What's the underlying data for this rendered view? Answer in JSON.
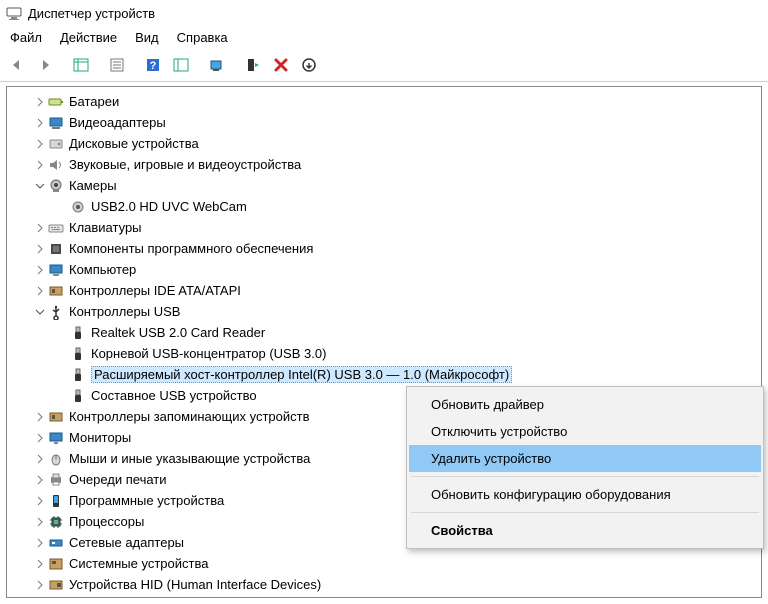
{
  "window": {
    "title": "Диспетчер устройств"
  },
  "menu": {
    "file": "Файл",
    "action": "Действие",
    "view": "Вид",
    "help": "Справка"
  },
  "tree": {
    "batteries": "Батареи",
    "video": "Видеоадаптеры",
    "disk": "Дисковые устройства",
    "sound": "Звуковые, игровые и видеоустройства",
    "cameras": "Камеры",
    "cam0": "USB2.0 HD UVC WebCam",
    "keyboards": "Клавиатуры",
    "software": "Компоненты программного обеспечения",
    "computer": "Компьютер",
    "ide": "Контроллеры IDE ATA/ATAPI",
    "usb": "Контроллеры USB",
    "usb0": "Realtek USB 2.0 Card Reader",
    "usb1": "Корневой USB-концентратор (USB 3.0)",
    "usb2": "Расширяемый хост-контроллер Intel(R) USB 3.0 — 1.0 (Майкрософт)",
    "usb3": "Составное USB устройство",
    "storage": "Контроллеры запоминающих устройств",
    "monitors": "Мониторы",
    "mice": "Мыши и иные указывающие устройства",
    "printq": "Очереди печати",
    "softdev": "Программные устройства",
    "cpu": "Процессоры",
    "net": "Сетевые адаптеры",
    "system": "Системные устройства",
    "hid": "Устройства HID (Human Interface Devices)"
  },
  "ctx": {
    "update": "Обновить драйвер",
    "disable": "Отключить устройство",
    "uninstall": "Удалить устройство",
    "scan": "Обновить конфигурацию оборудования",
    "props": "Свойства"
  }
}
